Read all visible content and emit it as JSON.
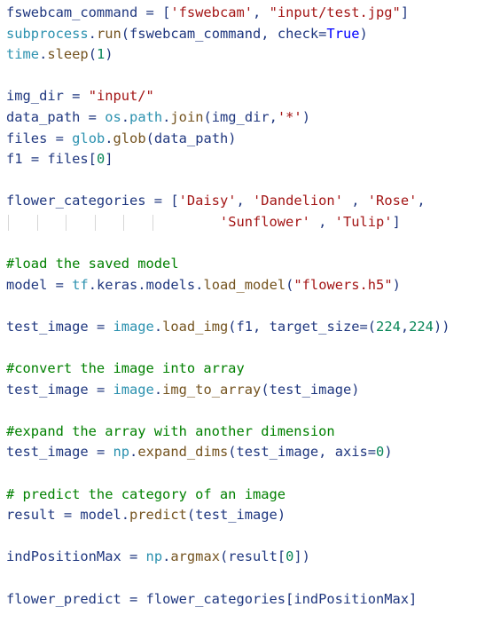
{
  "editor": {
    "lines": [
      {
        "tokens": [
          {
            "t": "fswebcam_command",
            "k": "var"
          },
          {
            "t": " = [",
            "k": "op"
          },
          {
            "t": "'fswebcam'",
            "k": "str"
          },
          {
            "t": ", ",
            "k": "op"
          },
          {
            "t": "\"input/test.jpg\"",
            "k": "str"
          },
          {
            "t": "]",
            "k": "op"
          }
        ]
      },
      {
        "tokens": [
          {
            "t": "subprocess",
            "k": "mod"
          },
          {
            "t": ".",
            "k": "op"
          },
          {
            "t": "run",
            "k": "fn"
          },
          {
            "t": "(fswebcam_command, check=",
            "k": "var"
          },
          {
            "t": "True",
            "k": "kw"
          },
          {
            "t": ")",
            "k": "op"
          }
        ]
      },
      {
        "tokens": [
          {
            "t": "time",
            "k": "mod"
          },
          {
            "t": ".",
            "k": "op"
          },
          {
            "t": "sleep",
            "k": "fn"
          },
          {
            "t": "(",
            "k": "op"
          },
          {
            "t": "1",
            "k": "num"
          },
          {
            "t": ")",
            "k": "op"
          }
        ]
      },
      {
        "tokens": []
      },
      {
        "tokens": [
          {
            "t": "img_dir",
            "k": "var"
          },
          {
            "t": " = ",
            "k": "op"
          },
          {
            "t": "\"input/\"",
            "k": "str"
          }
        ]
      },
      {
        "tokens": [
          {
            "t": "data_path",
            "k": "var"
          },
          {
            "t": " = ",
            "k": "op"
          },
          {
            "t": "os",
            "k": "mod"
          },
          {
            "t": ".",
            "k": "op"
          },
          {
            "t": "path",
            "k": "mod"
          },
          {
            "t": ".",
            "k": "op"
          },
          {
            "t": "join",
            "k": "fn"
          },
          {
            "t": "(img_dir,",
            "k": "var"
          },
          {
            "t": "'*'",
            "k": "str"
          },
          {
            "t": ")",
            "k": "op"
          }
        ]
      },
      {
        "tokens": [
          {
            "t": "files",
            "k": "var"
          },
          {
            "t": " = ",
            "k": "op"
          },
          {
            "t": "glob",
            "k": "mod"
          },
          {
            "t": ".",
            "k": "op"
          },
          {
            "t": "glob",
            "k": "fn"
          },
          {
            "t": "(data_path)",
            "k": "var"
          }
        ]
      },
      {
        "tokens": [
          {
            "t": "f1",
            "k": "var"
          },
          {
            "t": " = files[",
            "k": "op"
          },
          {
            "t": "0",
            "k": "num"
          },
          {
            "t": "]",
            "k": "op"
          }
        ]
      },
      {
        "tokens": []
      },
      {
        "tokens": [
          {
            "t": "flower_categories",
            "k": "var"
          },
          {
            "t": " = [",
            "k": "op"
          },
          {
            "t": "'Daisy'",
            "k": "str"
          },
          {
            "t": ", ",
            "k": "op"
          },
          {
            "t": "'Dandelion'",
            "k": "str"
          },
          {
            "t": " , ",
            "k": "op"
          },
          {
            "t": "'Rose'",
            "k": "str"
          },
          {
            "t": ",",
            "k": "op"
          }
        ]
      },
      {
        "tokens": [
          {
            "t": "                          ",
            "k": "op"
          },
          {
            "t": "'Sunflower'",
            "k": "str"
          },
          {
            "t": " , ",
            "k": "op"
          },
          {
            "t": "'Tulip'",
            "k": "str"
          },
          {
            "t": "]",
            "k": "op"
          }
        ]
      },
      {
        "tokens": []
      },
      {
        "tokens": [
          {
            "t": "#load the saved model",
            "k": "com"
          }
        ]
      },
      {
        "tokens": [
          {
            "t": "model",
            "k": "var"
          },
          {
            "t": " = ",
            "k": "op"
          },
          {
            "t": "tf",
            "k": "mod"
          },
          {
            "t": ".keras.models.",
            "k": "op"
          },
          {
            "t": "load_model",
            "k": "fn"
          },
          {
            "t": "(",
            "k": "op"
          },
          {
            "t": "\"flowers.h5\"",
            "k": "str"
          },
          {
            "t": ")",
            "k": "op"
          }
        ]
      },
      {
        "tokens": []
      },
      {
        "tokens": [
          {
            "t": "test_image",
            "k": "var"
          },
          {
            "t": " = ",
            "k": "op"
          },
          {
            "t": "image",
            "k": "mod"
          },
          {
            "t": ".",
            "k": "op"
          },
          {
            "t": "load_img",
            "k": "fn"
          },
          {
            "t": "(f1, target_size=(",
            "k": "var"
          },
          {
            "t": "224",
            "k": "num"
          },
          {
            "t": ",",
            "k": "op"
          },
          {
            "t": "224",
            "k": "num"
          },
          {
            "t": "))",
            "k": "op"
          }
        ]
      },
      {
        "tokens": []
      },
      {
        "tokens": [
          {
            "t": "#convert the image into array",
            "k": "com"
          }
        ]
      },
      {
        "tokens": [
          {
            "t": "test_image",
            "k": "var"
          },
          {
            "t": " = ",
            "k": "op"
          },
          {
            "t": "image",
            "k": "mod"
          },
          {
            "t": ".",
            "k": "op"
          },
          {
            "t": "img_to_array",
            "k": "fn"
          },
          {
            "t": "(test_image)",
            "k": "var"
          }
        ]
      },
      {
        "tokens": []
      },
      {
        "tokens": [
          {
            "t": "#expand the array with another dimension",
            "k": "com"
          }
        ]
      },
      {
        "tokens": [
          {
            "t": "test_image",
            "k": "var"
          },
          {
            "t": " = ",
            "k": "op"
          },
          {
            "t": "np",
            "k": "mod"
          },
          {
            "t": ".",
            "k": "op"
          },
          {
            "t": "expand_dims",
            "k": "fn"
          },
          {
            "t": "(test_image, axis=",
            "k": "var"
          },
          {
            "t": "0",
            "k": "num"
          },
          {
            "t": ")",
            "k": "op"
          }
        ]
      },
      {
        "tokens": []
      },
      {
        "tokens": [
          {
            "t": "# predict the category of an image",
            "k": "com"
          }
        ]
      },
      {
        "tokens": [
          {
            "t": "result",
            "k": "var"
          },
          {
            "t": " = model.",
            "k": "op"
          },
          {
            "t": "predict",
            "k": "fn"
          },
          {
            "t": "(test_image)",
            "k": "var"
          }
        ]
      },
      {
        "tokens": []
      },
      {
        "tokens": [
          {
            "t": "indPositionMax",
            "k": "var"
          },
          {
            "t": " = ",
            "k": "op"
          },
          {
            "t": "np",
            "k": "mod"
          },
          {
            "t": ".",
            "k": "op"
          },
          {
            "t": "argmax",
            "k": "fn"
          },
          {
            "t": "(result[",
            "k": "var"
          },
          {
            "t": "0",
            "k": "num"
          },
          {
            "t": "])",
            "k": "op"
          }
        ]
      },
      {
        "tokens": []
      },
      {
        "tokens": [
          {
            "t": "flower_predict",
            "k": "var"
          },
          {
            "t": " = flower_categories[indPositionMax]",
            "k": "op"
          }
        ]
      }
    ]
  },
  "theme": {
    "background": "#ffffff",
    "variable": "#1f377f",
    "string": "#a31515",
    "function": "#74531f",
    "module": "#2b91af",
    "number": "#098658",
    "keyword": "#0000ff",
    "comment": "#008000",
    "indent_guide": "#d6d6d6"
  }
}
